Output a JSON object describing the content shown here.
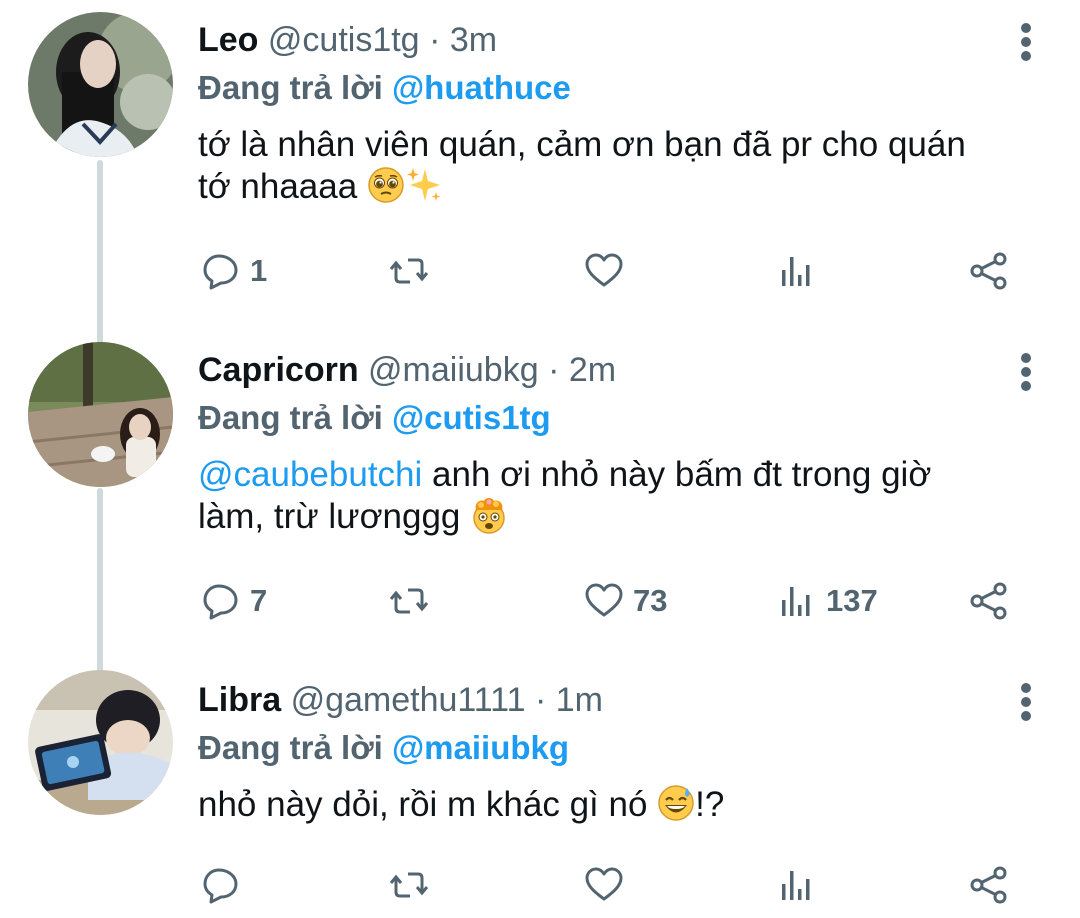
{
  "reply_prefix": "Đang trả lời",
  "tweets": [
    {
      "name": "Leo",
      "handle": "@cutis1tg",
      "dot": "·",
      "time": "3m",
      "reply_to": "@huathuce",
      "text": "tớ là nhân viên quán, cảm ơn bạn đã pr cho quán tớ nhaaaa",
      "emojis": [
        "pleading-face-emoji",
        "sparkles-emoji"
      ],
      "replies": "1",
      "retweets": "",
      "likes": "",
      "views": ""
    },
    {
      "name": "Capricorn",
      "handle": "@maiiubkg",
      "dot": "·",
      "time": "2m",
      "reply_to": "@cutis1tg",
      "mention": "@caubebutchi",
      "text": " anh ơi nhỏ này bấm đt trong giờ làm, trừ lươnggg",
      "emojis": [
        "exploding-head-emoji"
      ],
      "replies": "7",
      "retweets": "",
      "likes": "73",
      "views": "137"
    },
    {
      "name": "Libra",
      "handle": "@gamethu1111",
      "dot": "·",
      "time": "1m",
      "reply_to": "@maiiubkg",
      "text": "nhỏ này dỏi, rồi m khác gì nó",
      "text_suffix": "!?",
      "emojis": [
        "grinning-sweat-emoji"
      ],
      "replies": "",
      "retweets": "",
      "likes": "",
      "views": ""
    }
  ],
  "colors": {
    "accent": "#1d9bf0",
    "secondary_text": "#536471",
    "thread_line": "#cfd9de"
  }
}
